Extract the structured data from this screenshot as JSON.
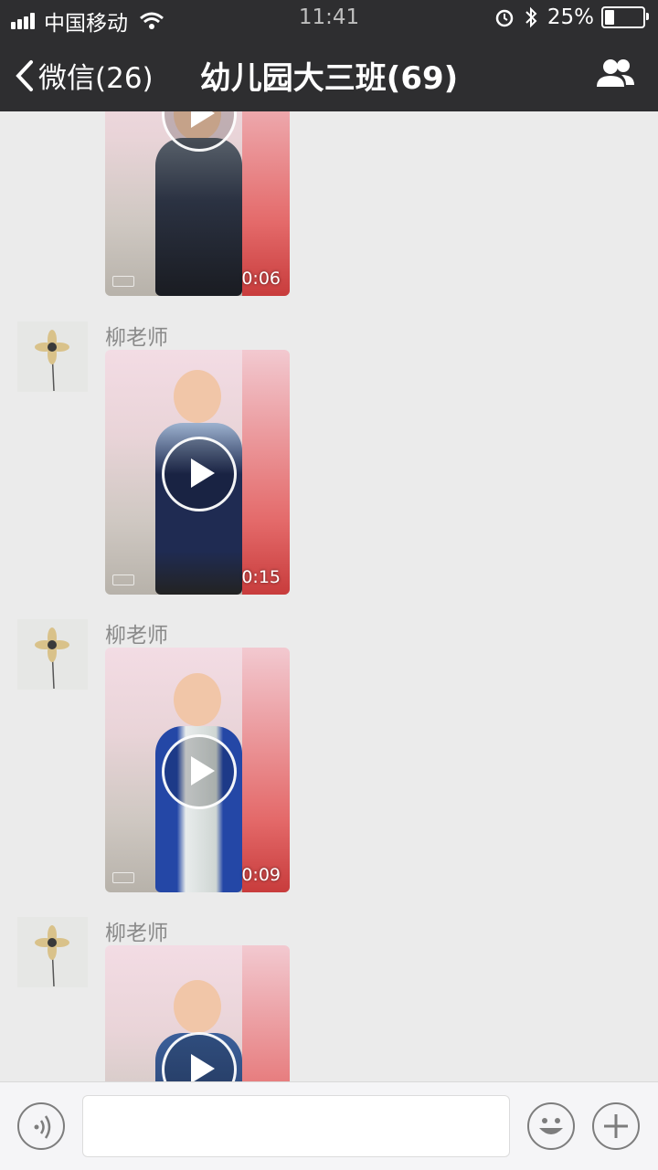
{
  "status": {
    "carrier": "中国移动",
    "time": "11:41",
    "battery_text": "25%"
  },
  "nav": {
    "back_label": "微信(26)",
    "title_visible": "幼儿园大三班(69)"
  },
  "messages": [
    {
      "sender": "",
      "duration": "0:06"
    },
    {
      "sender": "柳老师",
      "duration": "0:15"
    },
    {
      "sender": "柳老师",
      "duration": "0:09"
    },
    {
      "sender": "柳老师",
      "duration": ""
    }
  ],
  "input": {
    "placeholder": ""
  },
  "colors": {
    "topbar": "#2e2e30",
    "chat_bg": "#ebebeb",
    "input_bg": "#f5f5f7"
  },
  "icons": [
    "signal-icon",
    "wifi-icon",
    "alarm-icon",
    "bluetooth-icon",
    "battery-icon",
    "back-chevron-icon",
    "group-members-icon",
    "voice-icon",
    "emoji-icon",
    "plus-icon",
    "play-icon"
  ]
}
